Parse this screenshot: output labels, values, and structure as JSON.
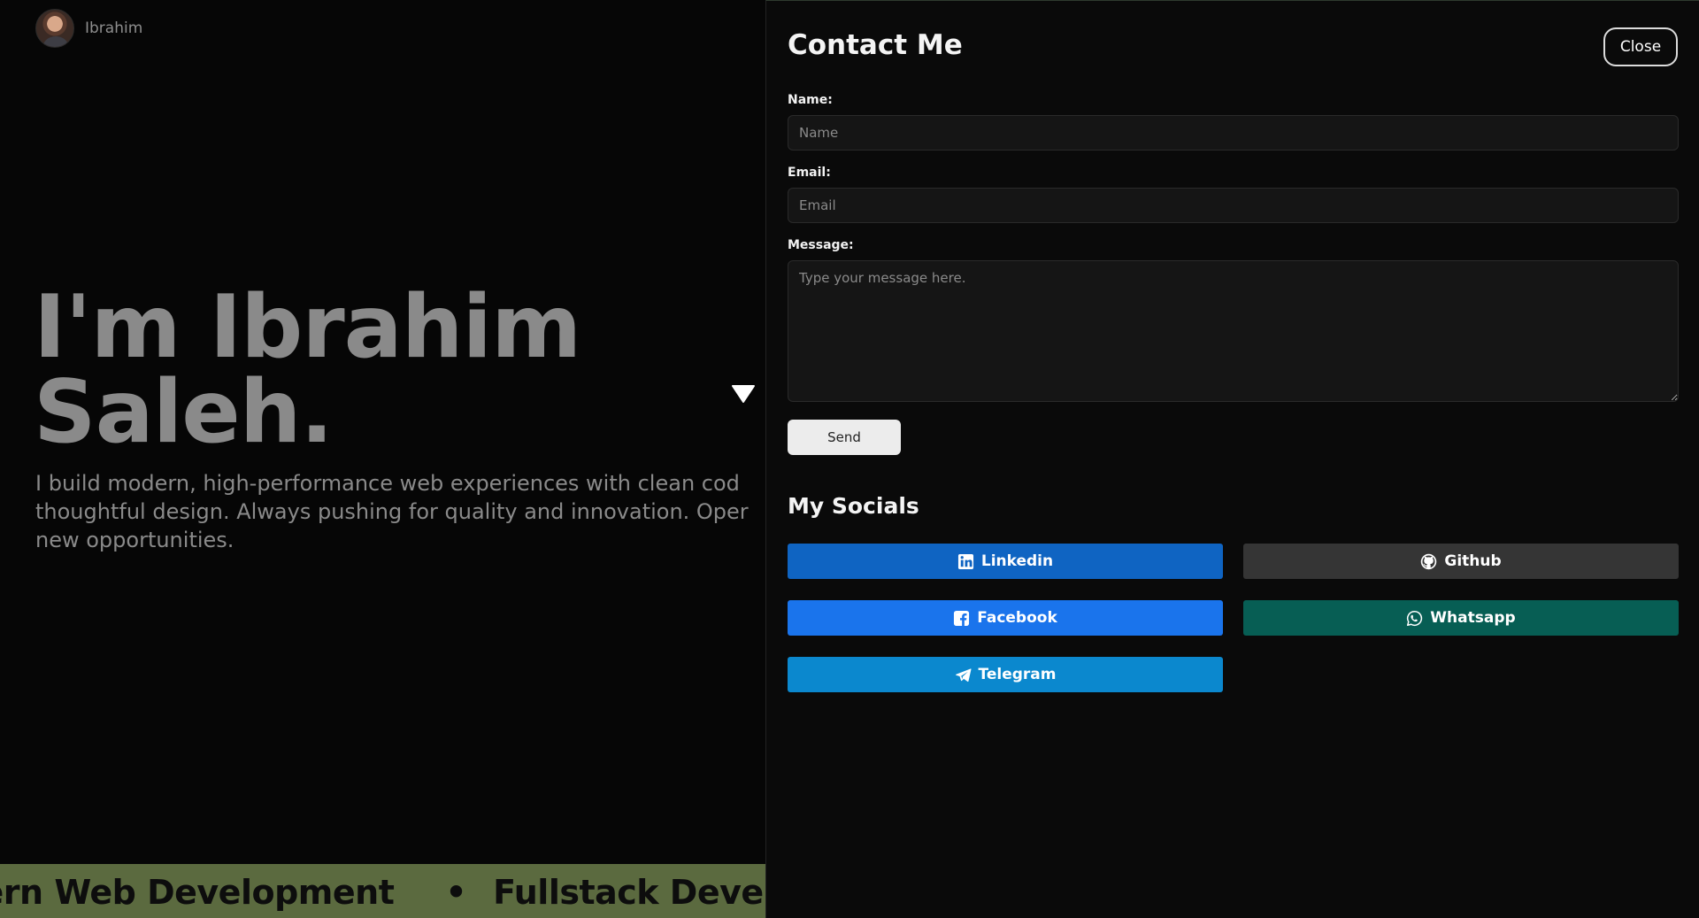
{
  "hero": {
    "brand_name": "Ibrahim",
    "title_line1": "I'm Ibrahim",
    "title_line2": "Saleh.",
    "description": "I build modern, high-performance web experiences with clean cod\n thoughtful design. Always pushing for quality and innovation. Oper\nnew opportunities.",
    "marquee_item1": "lern Web Development",
    "marquee_sep": "•",
    "marquee_item2": "Fullstack Develop"
  },
  "contact": {
    "title": "Contact Me",
    "close_label": "Close",
    "name_label": "Name:",
    "name_placeholder": "Name",
    "email_label": "Email:",
    "email_placeholder": "Email",
    "message_label": "Message:",
    "message_placeholder": "Type your message here.",
    "send_label": "Send"
  },
  "socials": {
    "title": "My Socials",
    "linkedin": "Linkedin",
    "github": "Github",
    "facebook": "Facebook",
    "whatsapp": "Whatsapp",
    "telegram": "Telegram"
  },
  "colors": {
    "linkedin": "#0f64c2",
    "github": "#353535",
    "facebook": "#1a74ec",
    "whatsapp": "#075e54",
    "telegram": "#0b88ce",
    "marquee_bg": "#5b6a3f"
  },
  "icons": [
    "avatar",
    "cursor-icon",
    "linkedin-icon",
    "github-icon",
    "facebook-icon",
    "whatsapp-icon",
    "telegram-icon"
  ]
}
